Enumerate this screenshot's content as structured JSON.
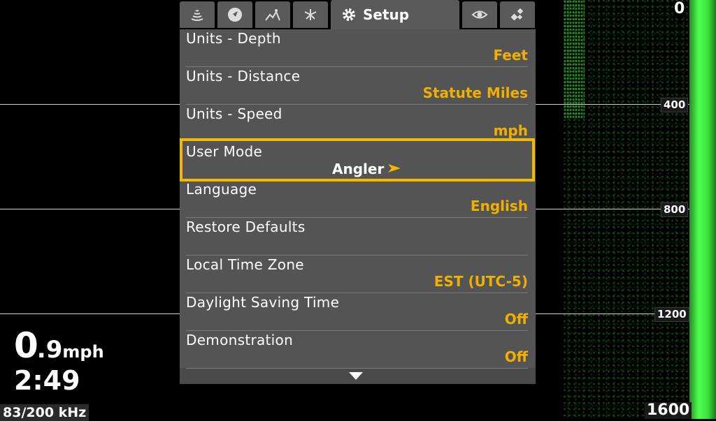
{
  "tabs": [
    {
      "icon": "sonar-icon"
    },
    {
      "icon": "navigation-icon"
    },
    {
      "icon": "chart-icon"
    },
    {
      "icon": "side-imaging-icon"
    },
    {
      "icon": "gear-icon",
      "label": "Setup"
    },
    {
      "icon": "eye-icon"
    },
    {
      "icon": "accessories-icon"
    }
  ],
  "menu": {
    "items": [
      {
        "label": "Units - Depth",
        "value": "Feet"
      },
      {
        "label": "Units - Distance",
        "value": "Statute Miles"
      },
      {
        "label": "Units - Speed",
        "value": "mph"
      },
      {
        "label": "User Mode",
        "value": "Angler"
      },
      {
        "label": "Language",
        "value": "English"
      },
      {
        "label": "Restore Defaults",
        "value": ""
      },
      {
        "label": "Local Time Zone",
        "value": "EST (UTC-5)"
      },
      {
        "label": "Daylight Saving Time",
        "value": "Off"
      },
      {
        "label": "Demonstration",
        "value": "Off"
      }
    ],
    "selected_index": 3
  },
  "depth_scale": {
    "top": "0",
    "ticks": [
      "400",
      "800",
      "1200"
    ],
    "bottom": "1600"
  },
  "readouts": {
    "speed_whole": "0",
    "speed_fraction": ".9",
    "speed_unit": "mph",
    "time": "2:49",
    "frequency": "83/200 kHz"
  },
  "colors": {
    "accent": "#f5b800",
    "value_text": "#f0b000",
    "sonar_green": "#4cff4c"
  }
}
